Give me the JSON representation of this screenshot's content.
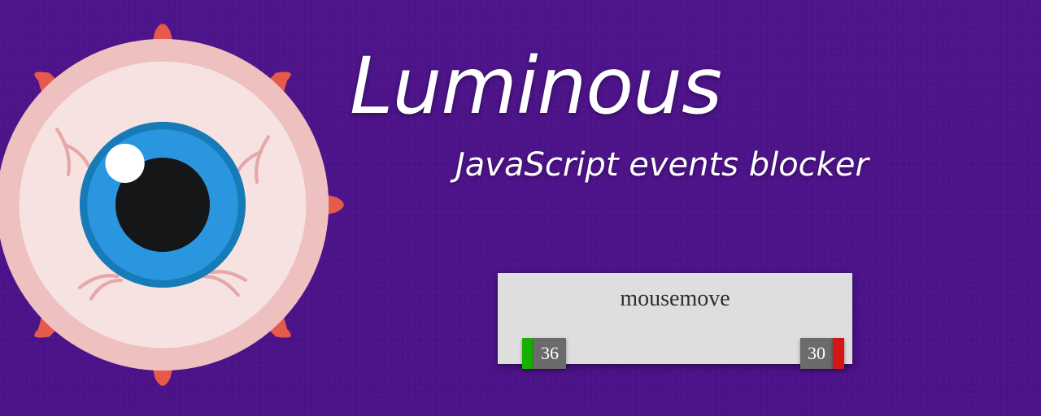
{
  "header": {
    "title": "Luminous",
    "subtitle": "JavaScript events blocker"
  },
  "event_panel": {
    "name": "mousemove",
    "allowed_count": "36",
    "blocked_count": "30"
  },
  "colors": {
    "background": "#4d138a",
    "panel_bg": "#dedede",
    "badge_bg": "#6b6b6b",
    "allowed_tick": "#18b000",
    "blocked_tick": "#d51616"
  }
}
